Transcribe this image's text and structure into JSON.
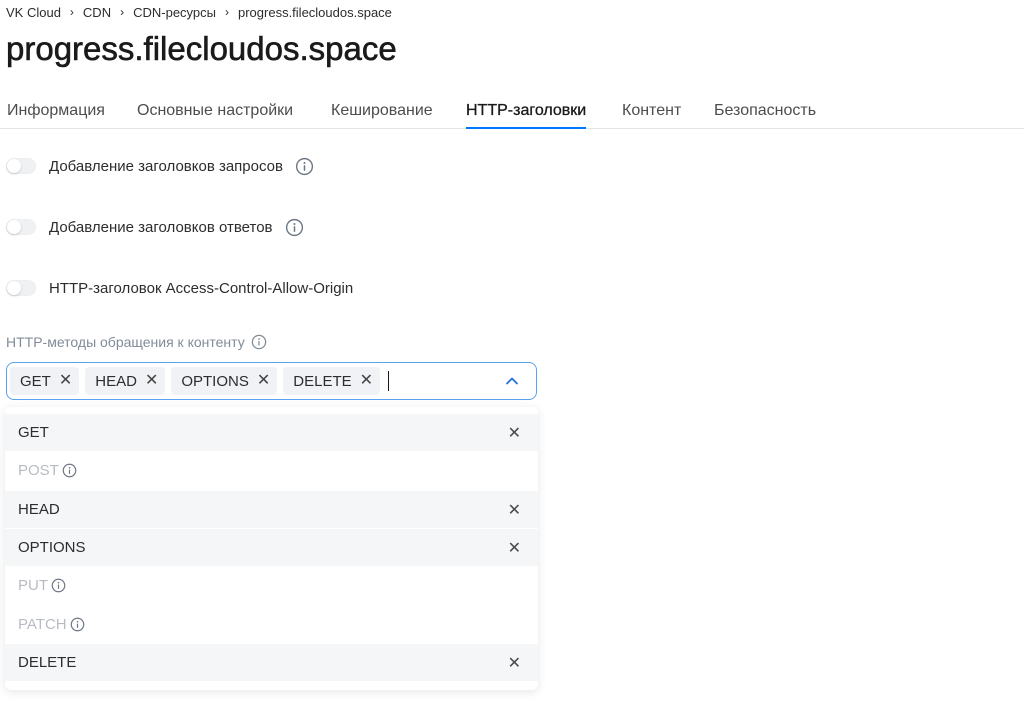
{
  "breadcrumbs": [
    "VK Cloud",
    "CDN",
    "CDN-ресурсы",
    "progress.filecloudos.space"
  ],
  "page_title": "progress.filecloudos.space",
  "tabs": [
    {
      "label": "Информация",
      "active": false
    },
    {
      "label": "Основные настройки",
      "active": false
    },
    {
      "label": "Кеширование",
      "active": false
    },
    {
      "label": "HTTP-заголовки",
      "active": true
    },
    {
      "label": "Контент",
      "active": false
    },
    {
      "label": "Безопасность",
      "active": false
    }
  ],
  "toggles": [
    {
      "label": "Добавление заголовков запросов",
      "enabled": false
    },
    {
      "label": "Добавление заголовков ответов",
      "enabled": false
    },
    {
      "label": "HTTP-заголовок Access-Control-Allow-Origin",
      "enabled": false
    }
  ],
  "methods_field": {
    "label": "HTTP-методы обращения к контенту",
    "selected": [
      "GET",
      "HEAD",
      "OPTIONS",
      "DELETE"
    ],
    "remove_glyph": "✕",
    "options": [
      {
        "label": "GET",
        "selected": true,
        "disabled": false
      },
      {
        "label": "POST",
        "selected": false,
        "disabled": true
      },
      {
        "label": "HEAD",
        "selected": true,
        "disabled": false
      },
      {
        "label": "OPTIONS",
        "selected": true,
        "disabled": false
      },
      {
        "label": "PUT",
        "selected": false,
        "disabled": true
      },
      {
        "label": "PATCH",
        "selected": false,
        "disabled": true
      },
      {
        "label": "DELETE",
        "selected": true,
        "disabled": false
      }
    ]
  },
  "colors": {
    "accent": "#0077ff",
    "focus_border": "#5aa2ee",
    "muted_text": "#818c99",
    "disabled_text": "#b8bcc2"
  },
  "icons": [
    "chevron-right-icon",
    "info-icon",
    "close-icon",
    "chevron-up-icon"
  ]
}
